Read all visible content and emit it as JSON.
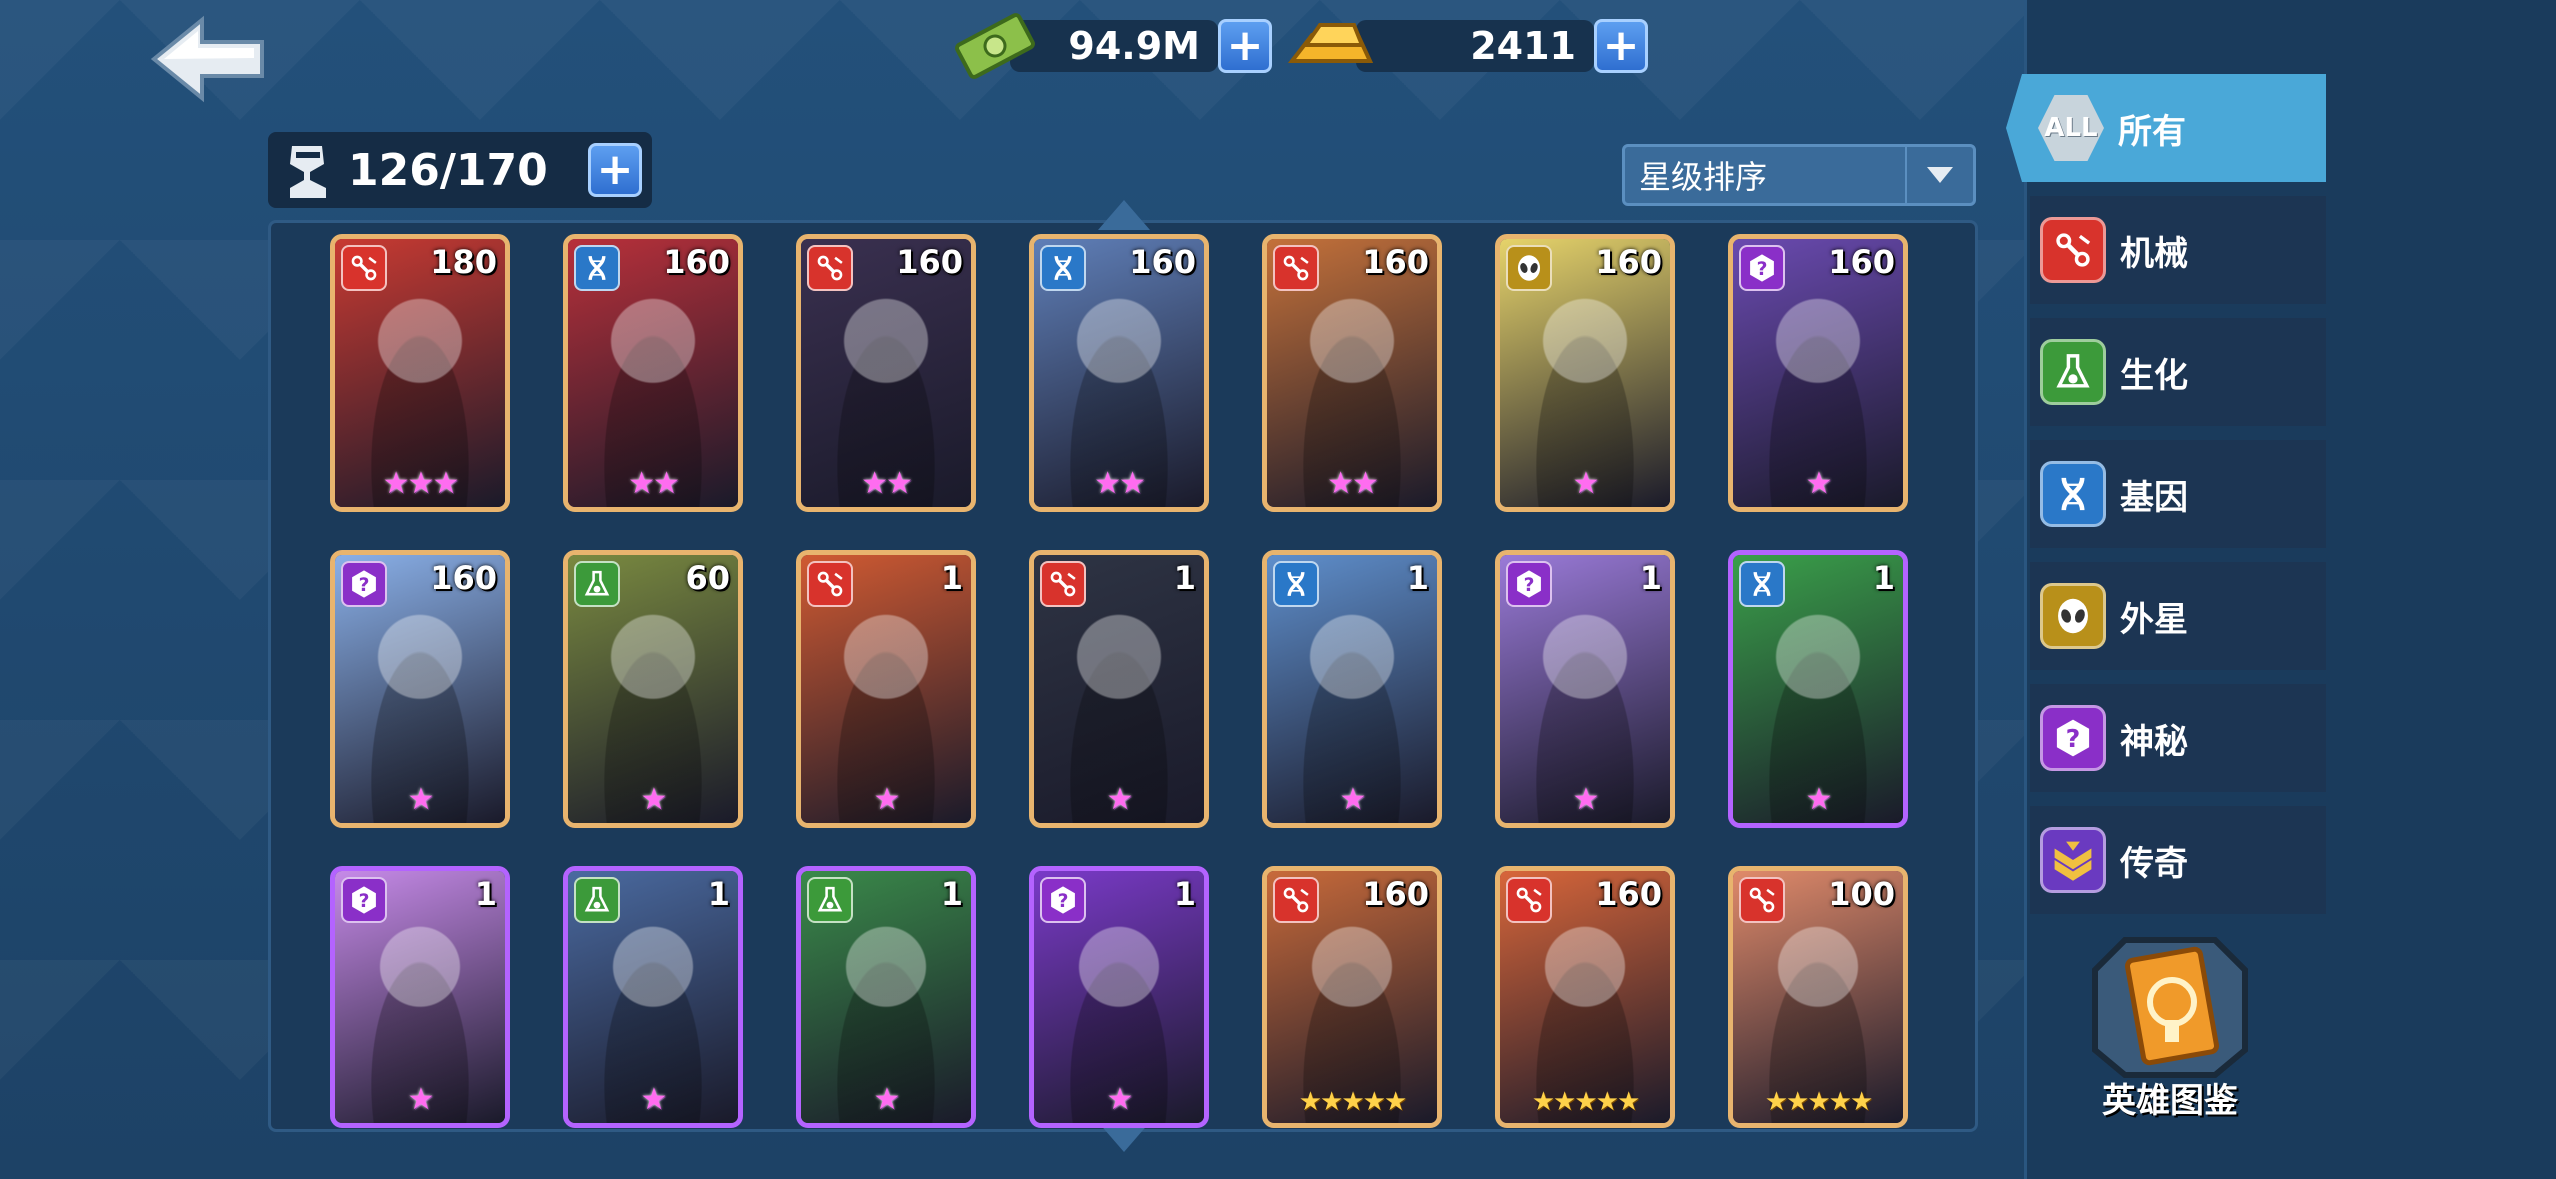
{
  "header": {
    "cash": "94.9M",
    "gold": "2411"
  },
  "capacity": "126/170",
  "sort": {
    "selected": "星级排序"
  },
  "filters": [
    {
      "label": "所有",
      "icon": "ALL",
      "key": "all",
      "active": true
    },
    {
      "label": "机械",
      "key": "mech"
    },
    {
      "label": "生化",
      "key": "bio"
    },
    {
      "label": "基因",
      "key": "gene"
    },
    {
      "label": "外星",
      "key": "alien"
    },
    {
      "label": "神秘",
      "key": "mystic"
    },
    {
      "label": "传奇",
      "key": "legend"
    }
  ],
  "codex_label": "英雄图鉴",
  "colors": {
    "mech": "#d8332c",
    "bio": "#3c9a3a",
    "gene": "#2a78c8",
    "alien": "#b8901a",
    "mystic": "#8a2fc8",
    "legend": "#6a3ac0"
  },
  "heroes": [
    {
      "faction": "mech",
      "level": "180",
      "stars": "★★★",
      "bg": "#c83a32"
    },
    {
      "faction": "gene",
      "level": "160",
      "stars": "★★",
      "bg": "#b8303a"
    },
    {
      "faction": "mech",
      "level": "160",
      "stars": "★★",
      "bg": "#3a3050"
    },
    {
      "faction": "gene",
      "level": "160",
      "stars": "★★",
      "bg": "#5f7fb8"
    },
    {
      "faction": "mech",
      "level": "160",
      "stars": "★★",
      "bg": "#c4713a"
    },
    {
      "faction": "alien",
      "level": "160",
      "stars": "★",
      "bg": "#e6d36a"
    },
    {
      "faction": "mystic",
      "level": "160",
      "stars": "★",
      "bg": "#6a4ab0"
    },
    {
      "faction": "mystic",
      "level": "160",
      "stars": "★",
      "bg": "#8ab0e8"
    },
    {
      "faction": "bio",
      "level": "60",
      "stars": "★",
      "bg": "#7a8a40"
    },
    {
      "faction": "mech",
      "level": "1",
      "stars": "★",
      "bg": "#d05a32"
    },
    {
      "faction": "mech",
      "level": "1",
      "stars": "★",
      "bg": "#2e3444"
    },
    {
      "faction": "gene",
      "level": "1",
      "stars": "★",
      "bg": "#5f8fcc"
    },
    {
      "faction": "mystic",
      "level": "1",
      "stars": "★",
      "bg": "#9a7ad8"
    },
    {
      "faction": "gene",
      "level": "1",
      "stars": "★",
      "bg": "#3aa04a",
      "border": "purple"
    },
    {
      "faction": "mystic",
      "level": "1",
      "stars": "★",
      "bg": "#c68ae8",
      "border": "purple"
    },
    {
      "faction": "bio",
      "level": "1",
      "stars": "★",
      "bg": "#4a6aa0",
      "border": "purple"
    },
    {
      "faction": "bio",
      "level": "1",
      "stars": "★",
      "bg": "#3a8a4a",
      "border": "purple"
    },
    {
      "faction": "mystic",
      "level": "1",
      "stars": "★",
      "bg": "#7a3ac8",
      "border": "purple"
    },
    {
      "faction": "mech",
      "level": "160",
      "stars": "★★★★★",
      "bg": "#c86a3a",
      "starStyle": "gold"
    },
    {
      "faction": "mech",
      "level": "160",
      "stars": "★★★★★",
      "bg": "#d8663a",
      "starStyle": "gold"
    },
    {
      "faction": "mech",
      "level": "100",
      "stars": "★★★★★",
      "bg": "#e08a6a",
      "starStyle": "gold"
    }
  ]
}
